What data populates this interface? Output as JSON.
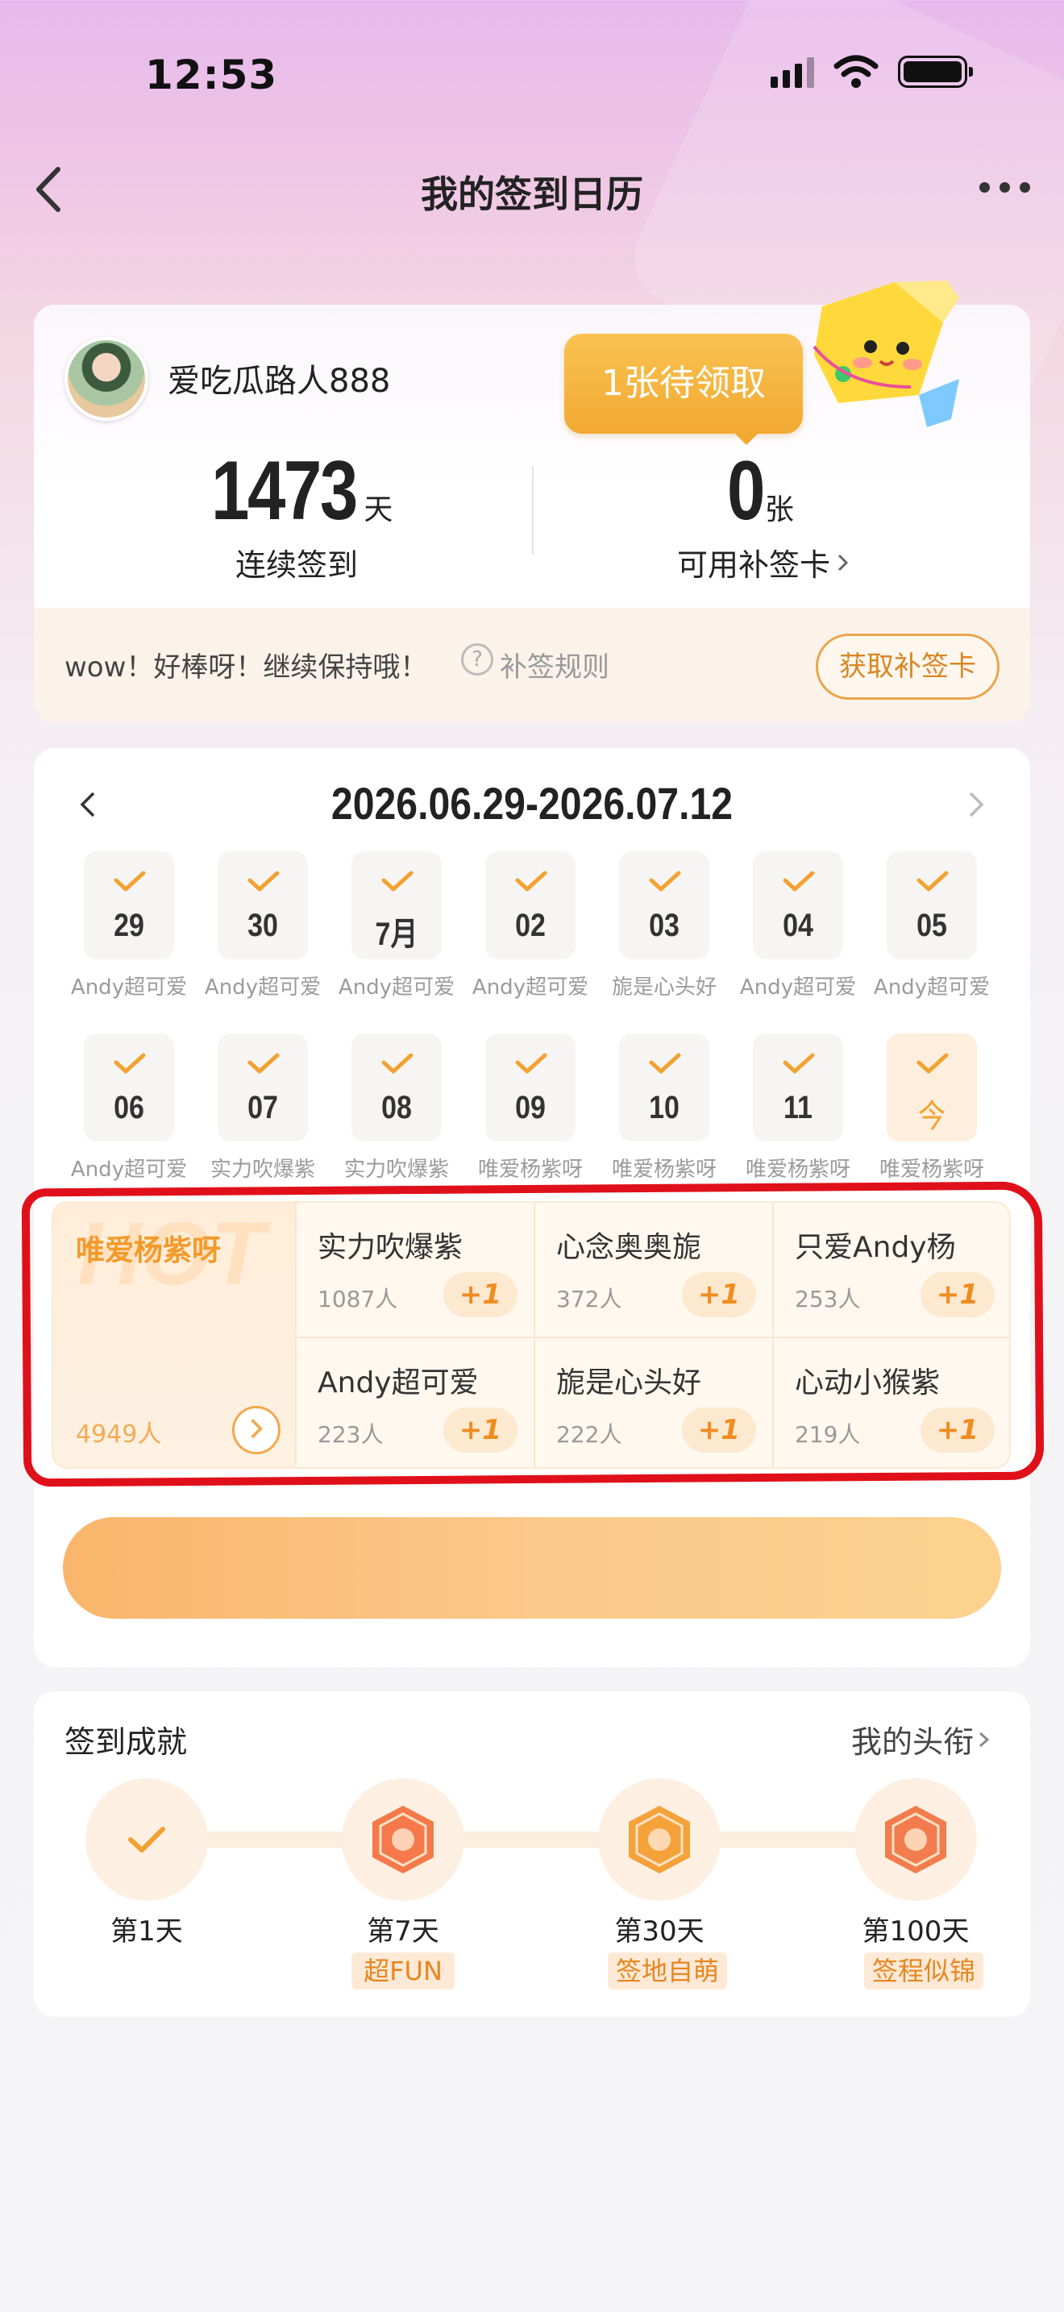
{
  "status_bar": {
    "time": "12:53"
  },
  "nav": {
    "title": "我的签到日历"
  },
  "profile": {
    "username": "爱吃瓜路人888",
    "streak_value": "1473",
    "streak_unit": "天",
    "streak_label": "连续签到",
    "cards_value": "0",
    "cards_unit": "张",
    "cards_label": "可用补签卡",
    "pending_bubble": "1张待领取",
    "tip": "wow！好棒呀！继续保持哦！",
    "rule_icon": "?",
    "rule_label": "补签规则",
    "get_card_button": "获取补签卡"
  },
  "calendar": {
    "date_range": "2026.06.29-2026.07.12",
    "days": [
      {
        "num": "29",
        "label": "Andy超可爱"
      },
      {
        "num": "30",
        "label": "Andy超可爱"
      },
      {
        "num": "7月",
        "label": "Andy超可爱"
      },
      {
        "num": "02",
        "label": "Andy超可爱"
      },
      {
        "num": "03",
        "label": "旎是心头好"
      },
      {
        "num": "04",
        "label": "Andy超可爱"
      },
      {
        "num": "05",
        "label": "Andy超可爱"
      },
      {
        "num": "06",
        "label": "Andy超可爱"
      },
      {
        "num": "07",
        "label": "实力吹爆紫"
      },
      {
        "num": "08",
        "label": "实力吹爆紫"
      },
      {
        "num": "09",
        "label": "唯爱杨紫呀"
      },
      {
        "num": "10",
        "label": "唯爱杨紫呀"
      },
      {
        "num": "11",
        "label": "唯爱杨紫呀"
      },
      {
        "num": "今",
        "label": "唯爱杨紫呀"
      }
    ]
  },
  "names": {
    "hot_watermark": "HOT",
    "hot": {
      "name": "唯爱杨紫呀",
      "count": "4949人"
    },
    "items": [
      {
        "name": "实力吹爆紫",
        "count": "1087人",
        "plus": "+1"
      },
      {
        "name": "心念奥奥旎",
        "count": "372人",
        "plus": "+1"
      },
      {
        "name": "只爱Andy杨",
        "count": "253人",
        "plus": "+1"
      },
      {
        "name": "Andy超可爱",
        "count": "223人",
        "plus": "+1"
      },
      {
        "name": "旎是心头好",
        "count": "222人",
        "plus": "+1"
      },
      {
        "name": "心动小猴紫",
        "count": "219人",
        "plus": "+1"
      }
    ]
  },
  "signin_button": "",
  "achievements": {
    "title": "签到成就",
    "link": "我的头衔",
    "medals": [
      {
        "day": "第1天",
        "tag": ""
      },
      {
        "day": "第7天",
        "tag": "超FUN"
      },
      {
        "day": "第30天",
        "tag": "签地自萌"
      },
      {
        "day": "第100天",
        "tag": "签程似锦"
      }
    ]
  },
  "colors": {
    "accent": "#f2a232",
    "bubble": "#f6b33d",
    "annotation_red": "#e0101a"
  }
}
